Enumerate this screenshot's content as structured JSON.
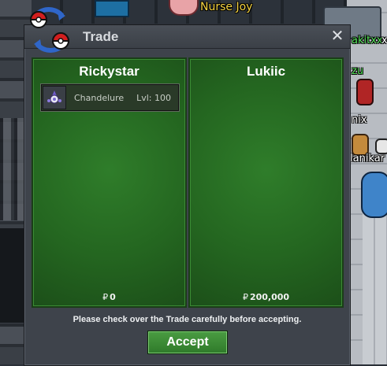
{
  "world": {
    "npc_name": "Nurse Joy",
    "players": [
      "akitxx",
      "x",
      "zu",
      "nix",
      "lanikar"
    ]
  },
  "trade_window": {
    "title": "Trade",
    "close_icon": "close-icon",
    "logo_icon": "pokeball-trade-icon",
    "left_panel": {
      "trader": "Rickystar",
      "items": [
        {
          "icon": "chandelure-sprite-icon",
          "name": "Chandelure",
          "level": "Lvl: 100"
        }
      ],
      "currency_symbol": "₽",
      "money": "0"
    },
    "right_panel": {
      "trader": "Lukiic",
      "items": [],
      "currency_symbol": "₽",
      "money": "200,000"
    },
    "notice": "Please check over the Trade carefully before accepting.",
    "accept_label": "Accept"
  },
  "colors": {
    "panel_green": "#246620",
    "button_green": "#3d8c36",
    "window_gray": "#3e434b"
  }
}
